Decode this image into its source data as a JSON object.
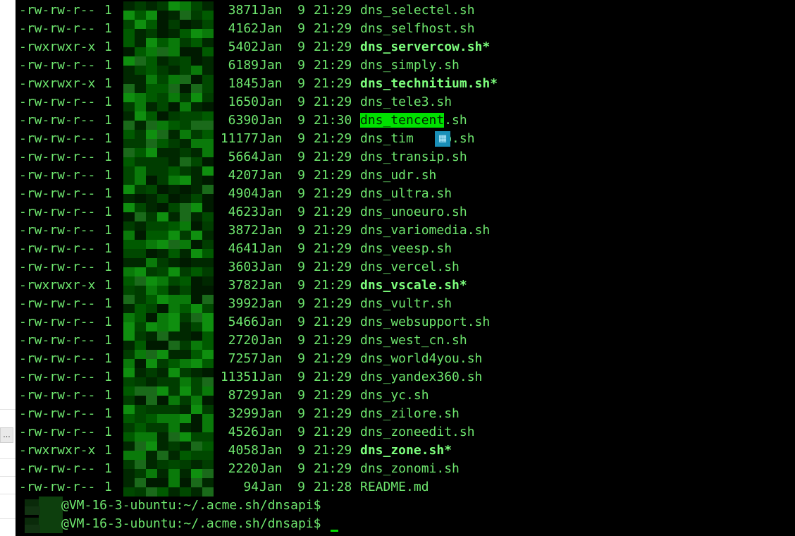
{
  "terminal": {
    "listing": [
      {
        "perm": "-rw-rw-r--",
        "links": "1",
        "size": "3871",
        "month": "Jan",
        "day": "9",
        "time": "21:29",
        "name": "dns_selectel.sh",
        "exec": false
      },
      {
        "perm": "-rw-rw-r--",
        "links": "1",
        "size": "4162",
        "month": "Jan",
        "day": "9",
        "time": "21:29",
        "name": "dns_selfhost.sh",
        "exec": false
      },
      {
        "perm": "-rwxrwxr-x",
        "links": "1",
        "size": "5402",
        "month": "Jan",
        "day": "9",
        "time": "21:29",
        "name": "dns_servercow.sh",
        "exec": true
      },
      {
        "perm": "-rw-rw-r--",
        "links": "1",
        "size": "6189",
        "month": "Jan",
        "day": "9",
        "time": "21:29",
        "name": "dns_simply.sh",
        "exec": false
      },
      {
        "perm": "-rwxrwxr-x",
        "links": "1",
        "size": "1845",
        "month": "Jan",
        "day": "9",
        "time": "21:29",
        "name": "dns_technitium.sh",
        "exec": true
      },
      {
        "perm": "-rw-rw-r--",
        "links": "1",
        "size": "1650",
        "month": "Jan",
        "day": "9",
        "time": "21:29",
        "name": "dns_tele3.sh",
        "exec": false
      },
      {
        "perm": "-rw-rw-r--",
        "links": "1",
        "size": "6390",
        "month": "Jan",
        "day": "9",
        "time": "21:30",
        "name_hl": "dns_tencent",
        "name_rest": ".sh",
        "exec": false
      },
      {
        "perm": "-rw-rw-r--",
        "links": "1",
        "size": "11177",
        "month": "Jan",
        "day": "9",
        "time": "21:29",
        "name": "dns_tim   eb.sh",
        "exec": false
      },
      {
        "perm": "-rw-rw-r--",
        "links": "1",
        "size": "5664",
        "month": "Jan",
        "day": "9",
        "time": "21:29",
        "name": "dns_transip.sh",
        "exec": false
      },
      {
        "perm": "-rw-rw-r--",
        "links": "1",
        "size": "4207",
        "month": "Jan",
        "day": "9",
        "time": "21:29",
        "name": "dns_udr.sh",
        "exec": false
      },
      {
        "perm": "-rw-rw-r--",
        "links": "1",
        "size": "4904",
        "month": "Jan",
        "day": "9",
        "time": "21:29",
        "name": "dns_ultra.sh",
        "exec": false
      },
      {
        "perm": "-rw-rw-r--",
        "links": "1",
        "size": "4623",
        "month": "Jan",
        "day": "9",
        "time": "21:29",
        "name": "dns_unoeuro.sh",
        "exec": false
      },
      {
        "perm": "-rw-rw-r--",
        "links": "1",
        "size": "3872",
        "month": "Jan",
        "day": "9",
        "time": "21:29",
        "name": "dns_variomedia.sh",
        "exec": false
      },
      {
        "perm": "-rw-rw-r--",
        "links": "1",
        "size": "4641",
        "month": "Jan",
        "day": "9",
        "time": "21:29",
        "name": "dns_veesp.sh",
        "exec": false
      },
      {
        "perm": "-rw-rw-r--",
        "links": "1",
        "size": "3603",
        "month": "Jan",
        "day": "9",
        "time": "21:29",
        "name": "dns_vercel.sh",
        "exec": false
      },
      {
        "perm": "-rwxrwxr-x",
        "links": "1",
        "size": "3782",
        "month": "Jan",
        "day": "9",
        "time": "21:29",
        "name": "dns_vscale.sh",
        "exec": true
      },
      {
        "perm": "-rw-rw-r--",
        "links": "1",
        "size": "3992",
        "month": "Jan",
        "day": "9",
        "time": "21:29",
        "name": "dns_vultr.sh",
        "exec": false
      },
      {
        "perm": "-rw-rw-r--",
        "links": "1",
        "size": "5466",
        "month": "Jan",
        "day": "9",
        "time": "21:29",
        "name": "dns_websupport.sh",
        "exec": false
      },
      {
        "perm": "-rw-rw-r--",
        "links": "1",
        "size": "2720",
        "month": "Jan",
        "day": "9",
        "time": "21:29",
        "name": "dns_west_cn.sh",
        "exec": false
      },
      {
        "perm": "-rw-rw-r--",
        "links": "1",
        "size": "7257",
        "month": "Jan",
        "day": "9",
        "time": "21:29",
        "name": "dns_world4you.sh",
        "exec": false
      },
      {
        "perm": "-rw-rw-r--",
        "links": "1",
        "size": "11351",
        "month": "Jan",
        "day": "9",
        "time": "21:29",
        "name": "dns_yandex360.sh",
        "exec": false
      },
      {
        "perm": "-rw-rw-r--",
        "links": "1",
        "size": "8729",
        "month": "Jan",
        "day": "9",
        "time": "21:29",
        "name": "dns_yc.sh",
        "exec": false
      },
      {
        "perm": "-rw-rw-r--",
        "links": "1",
        "size": "3299",
        "month": "Jan",
        "day": "9",
        "time": "21:29",
        "name": "dns_zilore.sh",
        "exec": false
      },
      {
        "perm": "-rw-rw-r--",
        "links": "1",
        "size": "4526",
        "month": "Jan",
        "day": "9",
        "time": "21:29",
        "name": "dns_zoneedit.sh",
        "exec": false
      },
      {
        "perm": "-rwxrwxr-x",
        "links": "1",
        "size": "4058",
        "month": "Jan",
        "day": "9",
        "time": "21:29",
        "name": "dns_zone.sh",
        "exec": true
      },
      {
        "perm": "-rw-rw-r--",
        "links": "1",
        "size": "2220",
        "month": "Jan",
        "day": "9",
        "time": "21:29",
        "name": "dns_zonomi.sh",
        "exec": false
      },
      {
        "perm": "-rw-rw-r--",
        "links": "1",
        "size": "94",
        "month": "Jan",
        "day": "9",
        "time": "21:28",
        "name": "README.md",
        "exec": false
      }
    ],
    "exec_marker": "*",
    "prompts": [
      {
        "text": "@VM-16-3-ubuntu:~/.acme.sh/dnsapi$"
      },
      {
        "text": "@VM-16-3-ubuntu:~/.acme.sh/dnsapi$"
      }
    ],
    "cursor_overlay_icon": "calendar-grid-icon",
    "cursor_overlay_glyph": "▦"
  },
  "side_panel": {
    "more_label": "..."
  },
  "colors": {
    "background": "#000000",
    "text": "#6ee66e",
    "exec_text": "#7dff7d",
    "highlight": "#00e000",
    "cursor": "#00dd00"
  }
}
